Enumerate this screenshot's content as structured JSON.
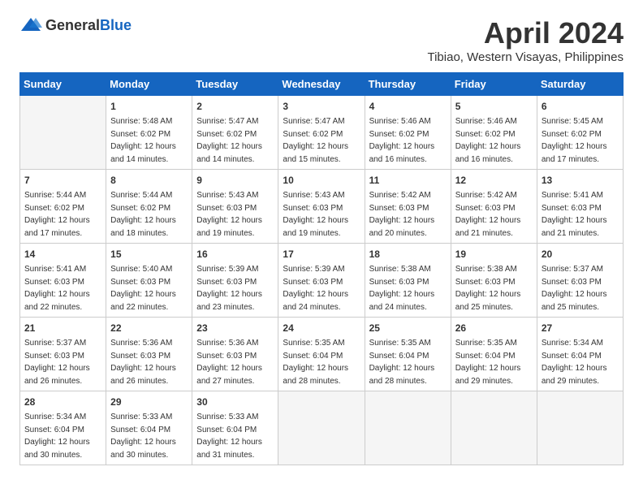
{
  "header": {
    "logo_general": "General",
    "logo_blue": "Blue",
    "title": "April 2024",
    "subtitle": "Tibiao, Western Visayas, Philippines"
  },
  "weekdays": [
    "Sunday",
    "Monday",
    "Tuesday",
    "Wednesday",
    "Thursday",
    "Friday",
    "Saturday"
  ],
  "weeks": [
    [
      {
        "day": "",
        "info": ""
      },
      {
        "day": "1",
        "info": "Sunrise: 5:48 AM\nSunset: 6:02 PM\nDaylight: 12 hours\nand 14 minutes."
      },
      {
        "day": "2",
        "info": "Sunrise: 5:47 AM\nSunset: 6:02 PM\nDaylight: 12 hours\nand 14 minutes."
      },
      {
        "day": "3",
        "info": "Sunrise: 5:47 AM\nSunset: 6:02 PM\nDaylight: 12 hours\nand 15 minutes."
      },
      {
        "day": "4",
        "info": "Sunrise: 5:46 AM\nSunset: 6:02 PM\nDaylight: 12 hours\nand 16 minutes."
      },
      {
        "day": "5",
        "info": "Sunrise: 5:46 AM\nSunset: 6:02 PM\nDaylight: 12 hours\nand 16 minutes."
      },
      {
        "day": "6",
        "info": "Sunrise: 5:45 AM\nSunset: 6:02 PM\nDaylight: 12 hours\nand 17 minutes."
      }
    ],
    [
      {
        "day": "7",
        "info": "Sunrise: 5:44 AM\nSunset: 6:02 PM\nDaylight: 12 hours\nand 17 minutes."
      },
      {
        "day": "8",
        "info": "Sunrise: 5:44 AM\nSunset: 6:02 PM\nDaylight: 12 hours\nand 18 minutes."
      },
      {
        "day": "9",
        "info": "Sunrise: 5:43 AM\nSunset: 6:03 PM\nDaylight: 12 hours\nand 19 minutes."
      },
      {
        "day": "10",
        "info": "Sunrise: 5:43 AM\nSunset: 6:03 PM\nDaylight: 12 hours\nand 19 minutes."
      },
      {
        "day": "11",
        "info": "Sunrise: 5:42 AM\nSunset: 6:03 PM\nDaylight: 12 hours\nand 20 minutes."
      },
      {
        "day": "12",
        "info": "Sunrise: 5:42 AM\nSunset: 6:03 PM\nDaylight: 12 hours\nand 21 minutes."
      },
      {
        "day": "13",
        "info": "Sunrise: 5:41 AM\nSunset: 6:03 PM\nDaylight: 12 hours\nand 21 minutes."
      }
    ],
    [
      {
        "day": "14",
        "info": "Sunrise: 5:41 AM\nSunset: 6:03 PM\nDaylight: 12 hours\nand 22 minutes."
      },
      {
        "day": "15",
        "info": "Sunrise: 5:40 AM\nSunset: 6:03 PM\nDaylight: 12 hours\nand 22 minutes."
      },
      {
        "day": "16",
        "info": "Sunrise: 5:39 AM\nSunset: 6:03 PM\nDaylight: 12 hours\nand 23 minutes."
      },
      {
        "day": "17",
        "info": "Sunrise: 5:39 AM\nSunset: 6:03 PM\nDaylight: 12 hours\nand 24 minutes."
      },
      {
        "day": "18",
        "info": "Sunrise: 5:38 AM\nSunset: 6:03 PM\nDaylight: 12 hours\nand 24 minutes."
      },
      {
        "day": "19",
        "info": "Sunrise: 5:38 AM\nSunset: 6:03 PM\nDaylight: 12 hours\nand 25 minutes."
      },
      {
        "day": "20",
        "info": "Sunrise: 5:37 AM\nSunset: 6:03 PM\nDaylight: 12 hours\nand 25 minutes."
      }
    ],
    [
      {
        "day": "21",
        "info": "Sunrise: 5:37 AM\nSunset: 6:03 PM\nDaylight: 12 hours\nand 26 minutes."
      },
      {
        "day": "22",
        "info": "Sunrise: 5:36 AM\nSunset: 6:03 PM\nDaylight: 12 hours\nand 26 minutes."
      },
      {
        "day": "23",
        "info": "Sunrise: 5:36 AM\nSunset: 6:03 PM\nDaylight: 12 hours\nand 27 minutes."
      },
      {
        "day": "24",
        "info": "Sunrise: 5:35 AM\nSunset: 6:04 PM\nDaylight: 12 hours\nand 28 minutes."
      },
      {
        "day": "25",
        "info": "Sunrise: 5:35 AM\nSunset: 6:04 PM\nDaylight: 12 hours\nand 28 minutes."
      },
      {
        "day": "26",
        "info": "Sunrise: 5:35 AM\nSunset: 6:04 PM\nDaylight: 12 hours\nand 29 minutes."
      },
      {
        "day": "27",
        "info": "Sunrise: 5:34 AM\nSunset: 6:04 PM\nDaylight: 12 hours\nand 29 minutes."
      }
    ],
    [
      {
        "day": "28",
        "info": "Sunrise: 5:34 AM\nSunset: 6:04 PM\nDaylight: 12 hours\nand 30 minutes."
      },
      {
        "day": "29",
        "info": "Sunrise: 5:33 AM\nSunset: 6:04 PM\nDaylight: 12 hours\nand 30 minutes."
      },
      {
        "day": "30",
        "info": "Sunrise: 5:33 AM\nSunset: 6:04 PM\nDaylight: 12 hours\nand 31 minutes."
      },
      {
        "day": "",
        "info": ""
      },
      {
        "day": "",
        "info": ""
      },
      {
        "day": "",
        "info": ""
      },
      {
        "day": "",
        "info": ""
      }
    ]
  ]
}
